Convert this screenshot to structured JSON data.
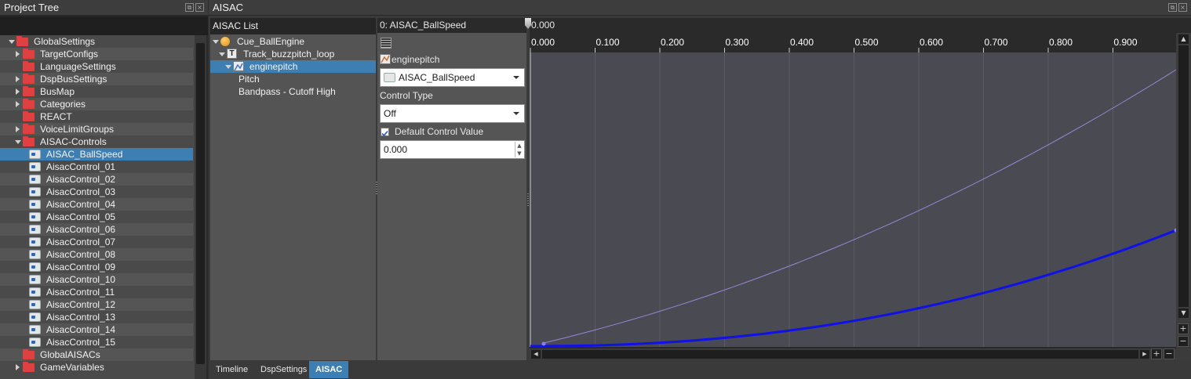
{
  "project_tree": {
    "title": "Project Tree",
    "items": [
      {
        "label": "GlobalSettings",
        "kind": "folder",
        "expander": "down",
        "indent": 0
      },
      {
        "label": "TargetConfigs",
        "kind": "folder",
        "expander": "right",
        "indent": 1
      },
      {
        "label": "LanguageSettings",
        "kind": "folder",
        "expander": "none",
        "indent": 1
      },
      {
        "label": "DspBusSettings",
        "kind": "folder",
        "expander": "right",
        "indent": 1
      },
      {
        "label": "BusMap",
        "kind": "folder",
        "expander": "right",
        "indent": 1
      },
      {
        "label": "Categories",
        "kind": "folder",
        "expander": "right",
        "indent": 1
      },
      {
        "label": "REACT",
        "kind": "folder",
        "expander": "none",
        "indent": 1
      },
      {
        "label": "VoiceLimitGroups",
        "kind": "folder",
        "expander": "right",
        "indent": 1
      },
      {
        "label": "AISAC-Controls",
        "kind": "folder",
        "expander": "down",
        "indent": 1
      },
      {
        "label": "AISAC_BallSpeed",
        "kind": "control",
        "expander": "none",
        "indent": 2,
        "selected": true
      },
      {
        "label": "AisacControl_01",
        "kind": "control",
        "expander": "none",
        "indent": 2
      },
      {
        "label": "AisacControl_02",
        "kind": "control",
        "expander": "none",
        "indent": 2
      },
      {
        "label": "AisacControl_03",
        "kind": "control",
        "expander": "none",
        "indent": 2
      },
      {
        "label": "AisacControl_04",
        "kind": "control",
        "expander": "none",
        "indent": 2
      },
      {
        "label": "AisacControl_05",
        "kind": "control",
        "expander": "none",
        "indent": 2
      },
      {
        "label": "AisacControl_06",
        "kind": "control",
        "expander": "none",
        "indent": 2
      },
      {
        "label": "AisacControl_07",
        "kind": "control",
        "expander": "none",
        "indent": 2
      },
      {
        "label": "AisacControl_08",
        "kind": "control",
        "expander": "none",
        "indent": 2
      },
      {
        "label": "AisacControl_09",
        "kind": "control",
        "expander": "none",
        "indent": 2
      },
      {
        "label": "AisacControl_10",
        "kind": "control",
        "expander": "none",
        "indent": 2
      },
      {
        "label": "AisacControl_11",
        "kind": "control",
        "expander": "none",
        "indent": 2
      },
      {
        "label": "AisacControl_12",
        "kind": "control",
        "expander": "none",
        "indent": 2
      },
      {
        "label": "AisacControl_13",
        "kind": "control",
        "expander": "none",
        "indent": 2
      },
      {
        "label": "AisacControl_14",
        "kind": "control",
        "expander": "none",
        "indent": 2
      },
      {
        "label": "AisacControl_15",
        "kind": "control",
        "expander": "none",
        "indent": 2
      },
      {
        "label": "GlobalAISACs",
        "kind": "folder",
        "expander": "none",
        "indent": 1
      },
      {
        "label": "GameVariables",
        "kind": "folder",
        "expander": "right",
        "indent": 1
      }
    ]
  },
  "aisac": {
    "title": "AISAC",
    "list_header": "AISAC List",
    "list_items": [
      {
        "label": "Cue_BallEngine",
        "icon": "cue-icon"
      },
      {
        "label": "Track_buzzpitch_loop",
        "icon": "track-icon"
      },
      {
        "label": "enginepitch",
        "icon": "aisac-graph-icon"
      },
      {
        "label": "Pitch",
        "icon": ""
      },
      {
        "label": "Bandpass - Cutoff High",
        "icon": ""
      }
    ],
    "props": {
      "header": "0: AISAC_BallSpeed",
      "graph_name": "enginepitch",
      "control_value": "AISAC_BallSpeed",
      "control_type_label": "Control Type",
      "control_type_value": "Off",
      "default_control_checkbox_label": "Default Control Value",
      "default_control_checked": true,
      "default_control_value": "0.000"
    },
    "graph": {
      "cursor_value": "0.000",
      "ticks": [
        "0.000",
        "0.100",
        "0.200",
        "0.300",
        "0.400",
        "0.500",
        "0.600",
        "0.700",
        "0.800",
        "0.900"
      ],
      "curve_color": "#1010e8",
      "ref_curve_color": "#9a86d6"
    },
    "tabs": [
      "Timeline",
      "DspSettings",
      "AISAC"
    ],
    "active_tab": "AISAC"
  },
  "colors": {
    "selection": "#3d7fb3",
    "graph_bg": "#4a4a52",
    "folder": "#e04040"
  }
}
